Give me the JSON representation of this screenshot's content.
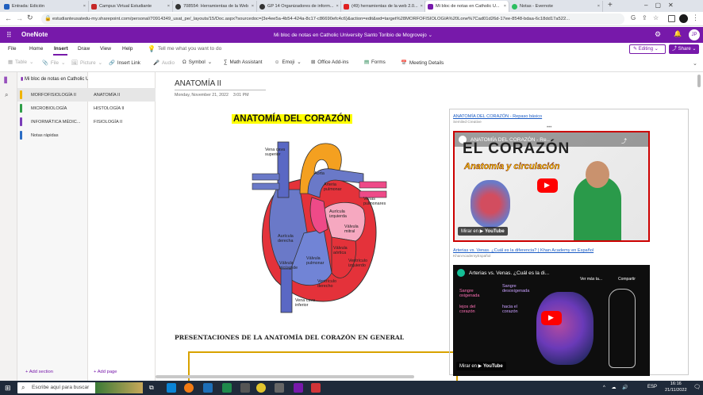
{
  "browser": {
    "tabs": [
      {
        "title": "Entrada: Edición",
        "color": "#1f5fbf"
      },
      {
        "title": "Campus Virtual Estudiante",
        "color": "#c62828"
      },
      {
        "title": "708554: Herramientas de la Web",
        "color": "#333333"
      },
      {
        "title": "GP 14 Organizadores de inform...",
        "color": "#333333"
      },
      {
        "title": "(49) herramientas de la web 2.0...",
        "color": "#e02020"
      },
      {
        "title": "Mi bloc de notas en Catholic U...",
        "color": "#7719aa"
      },
      {
        "title": "Notas - Evernote",
        "color": "#2dbe60"
      }
    ],
    "new_tab": "+",
    "url": "estudianteusatedu-my.sharepoint.com/personal/70914349_usat_pe/_layouts/15/Doc.aspx?sourcedoc={3e4ee5a-4b54-424a-8c17-c86690efc4c6}&action=edit&wd=target%28MORFOFISIOLOGIA%20Lone%7Cad01d26d-17ee-8548-bdaa-6c18dd17a522..."
  },
  "onenote": {
    "app_name": "OneNote",
    "notebook_title": "Mi bloc de notas en Catholic University Santo Toribio de Mogrovejo",
    "header_color": "#7719aa"
  },
  "ribbon": {
    "tabs": [
      "File",
      "Home",
      "Insert",
      "Draw",
      "View",
      "Help"
    ],
    "active_tab": "Insert",
    "tell_me": "Tell me what you want to do",
    "editing_label": "Editing",
    "share_label": "Share",
    "tools": [
      {
        "label": "Table",
        "enabled": false,
        "icon": "table-icon"
      },
      {
        "label": "File",
        "enabled": false,
        "icon": "file-icon"
      },
      {
        "label": "Picture",
        "enabled": false,
        "icon": "picture-icon"
      },
      {
        "label": "Insert Link",
        "enabled": true,
        "icon": "link-icon"
      },
      {
        "label": "Audio",
        "enabled": false,
        "icon": "audio-icon"
      },
      {
        "label": "Symbol",
        "enabled": true,
        "icon": "symbol-icon"
      },
      {
        "label": "Math Assistant",
        "enabled": true,
        "icon": "math-icon"
      },
      {
        "label": "Emoji",
        "enabled": true,
        "icon": "emoji-icon"
      },
      {
        "label": "Office Add-ins",
        "enabled": true,
        "icon": "addins-icon"
      },
      {
        "label": "Forms",
        "enabled": true,
        "icon": "forms-icon"
      },
      {
        "label": "Meeting Details",
        "enabled": true,
        "icon": "meeting-icon"
      }
    ]
  },
  "navigation": {
    "notebook_name": "Mi bloc de notas en Catholic University Santo Toribio ...",
    "sections": [
      {
        "label": "MORFOFISIOLOGÍA II",
        "color": "#f0b400",
        "selected": true
      },
      {
        "label": "MICROBIOLOGÍA",
        "color": "#2e9e48",
        "selected": false
      },
      {
        "label": "INFORMÁTICA MÉDIC...",
        "color": "#7a3db8",
        "selected": false
      },
      {
        "label": "Notas rápidas",
        "color": "#2b6cc4",
        "selected": false
      }
    ],
    "pages": [
      {
        "label": "ANATOMÍA II",
        "selected": true
      },
      {
        "label": "HISTOLOGÍA II",
        "selected": false
      },
      {
        "label": "FISIOLOGÍA II",
        "selected": false
      }
    ],
    "add_section": "Add section",
    "add_page": "Add page"
  },
  "page": {
    "title": "ANATOMÍA II",
    "date": "Monday, November 21, 2022",
    "time": "3:01 PM",
    "heading": "ANATOMÍA DEL CORAZÓN",
    "subheading": "PRESENTACIONES DE LA ANATOMÍA DEL CORAZÓN EN GENERAL",
    "diagram_labels": {
      "vena_cava_superior": "Vena cava superior",
      "aorta": "Aorta",
      "arteria_pulmonar": "Arteria pulmonar",
      "venas_pulmonares": "Venas pulmonares",
      "auricula_izquierda": "Aurícula izquierda",
      "valvula_mitral": "Válvula mitral",
      "auricula_derecha": "Aurícula derecha",
      "valvula_aortica": "Válvula aórtica",
      "valvula_tricuspide": "Válvula tricúspide",
      "valvula_pulmonar": "Válvula pulmonar",
      "ventriculo_izquierdo": "Ventrículo izquierdo",
      "ventriculo_derecho": "Ventrículo derecho",
      "vena_cava_inferior": "Vena cava inferior"
    },
    "videos": [
      {
        "link": "ANATOMÍA DEL CORAZÓN - Repaso básico",
        "source": "Semiled Creative",
        "player_title": "ANATOMÍA DEL CORAZÓN - Re...",
        "thumb_line1": "EL CORAZÓN",
        "thumb_line2": "Anatomía y circulación",
        "watch_on": "Mirar en",
        "platform": "YouTube"
      },
      {
        "link": "Arterias vs. Venas. ¿Cuál es la diferencia? | Khan Academy en Español",
        "source": "KhanAcademyEspañol",
        "player_title": "Arterias vs. Venas. ¿Cuál es la di...",
        "watch_later": "Ver más ta...",
        "share": "Compartir",
        "note_1": "Sangre oxigenada",
        "note_2": "Sangre desoxigenada",
        "note_3": "lejos del corazón",
        "note_4": "hacia el corazón",
        "watch_on": "Mirar en",
        "platform": "YouTube"
      }
    ]
  },
  "taskbar": {
    "search_placeholder": "Escribe aquí para buscar",
    "language": "ESP",
    "time": "16:16",
    "date": "21/11/2022"
  }
}
